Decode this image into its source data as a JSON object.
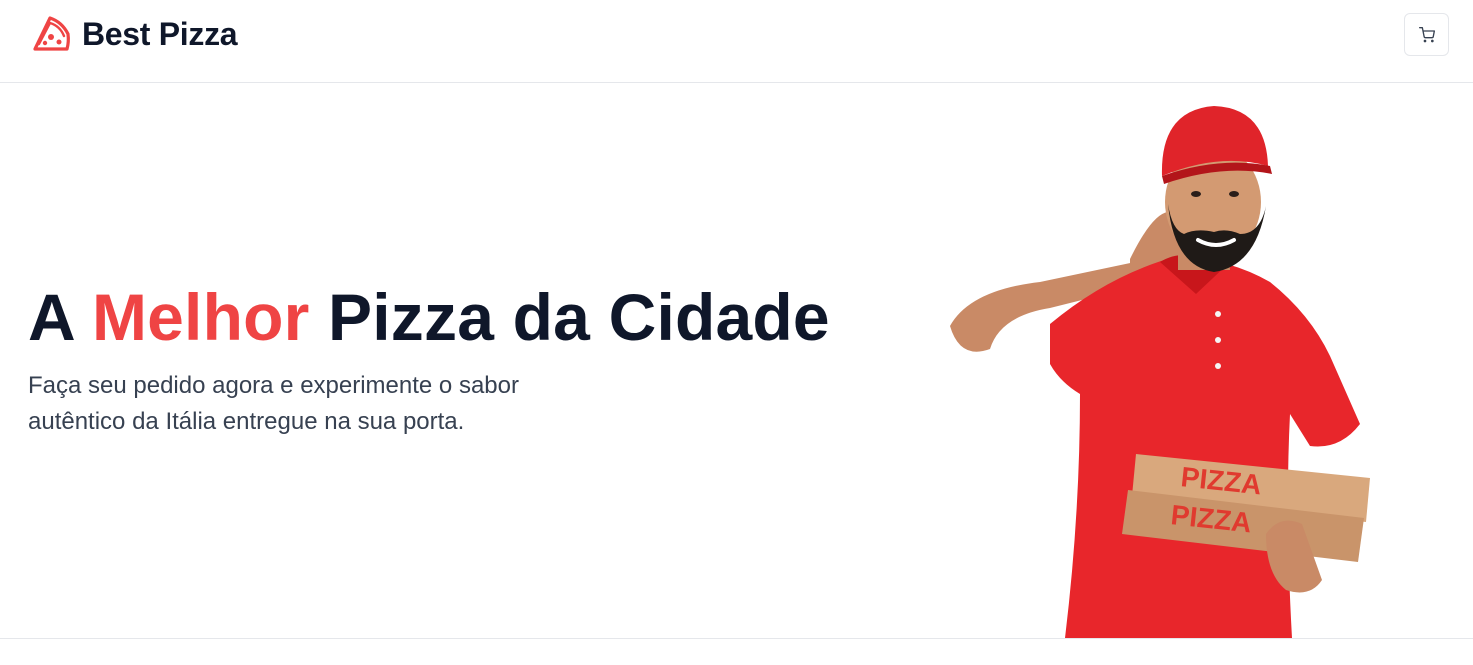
{
  "header": {
    "brand_name": "Best Pizza",
    "logo_icon": "pizza-slice-icon",
    "cart_icon": "shopping-cart-icon"
  },
  "hero": {
    "title_before": "A ",
    "title_accent": "Melhor",
    "title_after": " Pizza da Cidade",
    "subtitle": "Faça seu pedido agora e experimente o sabor autêntico da Itália entregue na sua porta.",
    "image_box_text": "PIZZA"
  },
  "colors": {
    "accent": "#ef4444",
    "heading": "#0f172a",
    "text": "#374151",
    "border": "#e5e7eb",
    "shirt": "#e8262b",
    "box": "#d9a87d"
  }
}
